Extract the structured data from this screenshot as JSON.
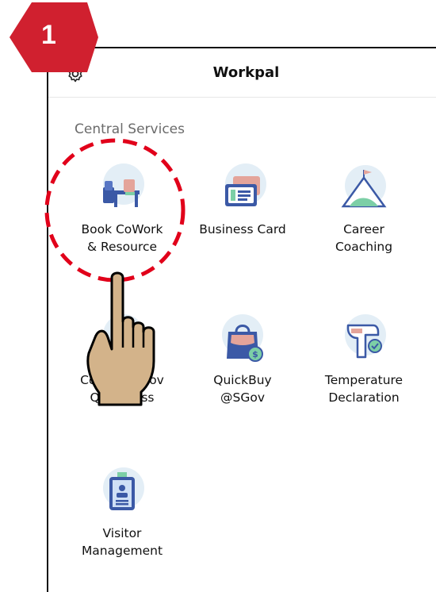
{
  "step_badge": {
    "number": "1",
    "color": "#d0202f"
  },
  "header": {
    "title": "Workpal"
  },
  "section": {
    "title": "Central Services"
  },
  "tiles": [
    {
      "icon": "desk-chair-icon",
      "line1": "Book CoWork",
      "line2": "& Resource"
    },
    {
      "icon": "business-card-icon",
      "line1": "Business Card",
      "line2": ""
    },
    {
      "icon": "mountain-flag-icon",
      "line1": "Career",
      "line2": "Coaching"
    },
    {
      "icon": "qr-phone-icon",
      "line1": "CoWork@Gov",
      "line2": "QR Access"
    },
    {
      "icon": "shopping-bag-icon",
      "line1": "QuickBuy",
      "line2": "@SGov"
    },
    {
      "icon": "thermometer-gun-icon",
      "line1": "Temperature",
      "line2": "Declaration"
    },
    {
      "icon": "visitor-badge-icon",
      "line1": "Visitor",
      "line2": "Management"
    }
  ],
  "colors": {
    "highlight": "#e1001a",
    "hand_fill": "#d3b38a",
    "icon_blue": "#3b59a6",
    "icon_green": "#7ccfa6"
  }
}
